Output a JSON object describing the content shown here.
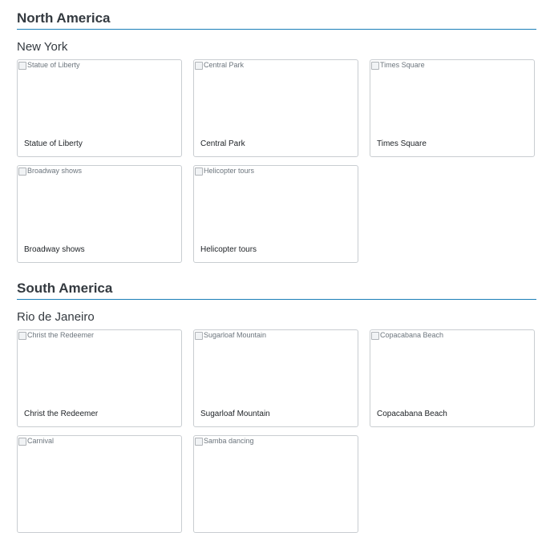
{
  "regions": [
    {
      "title": "North America",
      "city": "New York",
      "cards": [
        {
          "alt": "Statue of Liberty",
          "title": "Statue of Liberty"
        },
        {
          "alt": "Central Park",
          "title": "Central Park"
        },
        {
          "alt": "Times Square",
          "title": "Times Square"
        },
        {
          "alt": "Broadway shows",
          "title": "Broadway shows"
        },
        {
          "alt": "Helicopter tours",
          "title": "Helicopter tours"
        }
      ]
    },
    {
      "title": "South America",
      "city": "Rio de Janeiro",
      "cards": [
        {
          "alt": "Christ the Redeemer",
          "title": "Christ the Redeemer"
        },
        {
          "alt": "Sugarloaf Mountain",
          "title": "Sugarloaf Mountain"
        },
        {
          "alt": "Copacabana Beach",
          "title": "Copacabana Beach"
        },
        {
          "alt": "Carnival",
          "title": ""
        },
        {
          "alt": "Samba dancing",
          "title": ""
        }
      ]
    }
  ],
  "icons": {
    "image_placeholder": "broken-image-icon"
  },
  "colors": {
    "accent_rule": "#1b7fb8",
    "card_border": "#c9cdd1"
  }
}
